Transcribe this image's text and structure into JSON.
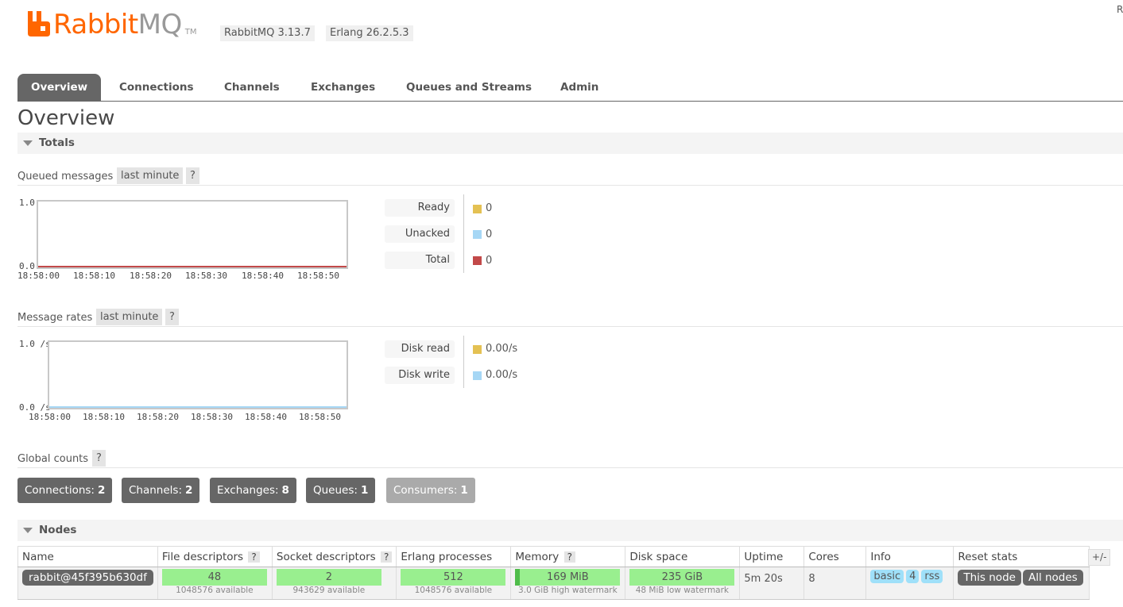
{
  "header": {
    "logo_rabbit": "Rabbit",
    "logo_mq": "MQ",
    "logo_tm": "TM",
    "rabbitmq_version": "RabbitMQ 3.13.7",
    "erlang_version": "Erlang 26.2.5.3",
    "corner_text": "R"
  },
  "tabs": [
    "Overview",
    "Connections",
    "Channels",
    "Exchanges",
    "Queues and Streams",
    "Admin"
  ],
  "page_title": "Overview",
  "totals": {
    "section_label": "Totals",
    "queued": {
      "title": "Queued messages",
      "range": "last minute",
      "help": "?",
      "y_max": "1.0",
      "y_min": "0.0",
      "x_ticks": [
        "18:58:00",
        "18:58:10",
        "18:58:20",
        "18:58:30",
        "18:58:40",
        "18:58:50"
      ],
      "legend": [
        {
          "label": "Ready",
          "value": "0",
          "color": "#e4c153"
        },
        {
          "label": "Unacked",
          "value": "0",
          "color": "#a6d7f5"
        },
        {
          "label": "Total",
          "value": "0",
          "color": "#c24949"
        }
      ]
    },
    "rates": {
      "title": "Message rates",
      "range": "last minute",
      "help": "?",
      "y_max": "1.0 /s",
      "y_min": "0.0 /s",
      "x_ticks": [
        "18:58:00",
        "18:58:10",
        "18:58:20",
        "18:58:30",
        "18:58:40",
        "18:58:50"
      ],
      "legend": [
        {
          "label": "Disk read",
          "value": "0.00/s",
          "color": "#e4c153"
        },
        {
          "label": "Disk write",
          "value": "0.00/s",
          "color": "#a6d7f5"
        }
      ]
    },
    "global": {
      "title": "Global counts",
      "help": "?",
      "counts": [
        {
          "label": "Connections:",
          "value": "2"
        },
        {
          "label": "Channels:",
          "value": "2"
        },
        {
          "label": "Exchanges:",
          "value": "8"
        },
        {
          "label": "Queues:",
          "value": "1"
        },
        {
          "label": "Consumers:",
          "value": "1"
        }
      ]
    }
  },
  "nodes": {
    "section_label": "Nodes",
    "plus_minus": "+/-",
    "columns": [
      "Name",
      "File descriptors",
      "Socket descriptors",
      "Erlang processes",
      "Memory",
      "Disk space",
      "Uptime",
      "Cores",
      "Info",
      "Reset stats"
    ],
    "help": "?",
    "row": {
      "name": "rabbit@45f395b630df",
      "fd": "48",
      "fd_sub": "1048576 available",
      "sd": "2",
      "sd_sub": "943629 available",
      "ep": "512",
      "ep_sub": "1048576 available",
      "mem": "169 MiB",
      "mem_sub": "3.0 GiB high watermark",
      "disk": "235 GiB",
      "disk_sub": "48 MiB low watermark",
      "uptime": "5m 20s",
      "cores": "8",
      "info": [
        "basic",
        "4",
        "rss"
      ],
      "reset": [
        "This node",
        "All nodes"
      ]
    }
  }
}
